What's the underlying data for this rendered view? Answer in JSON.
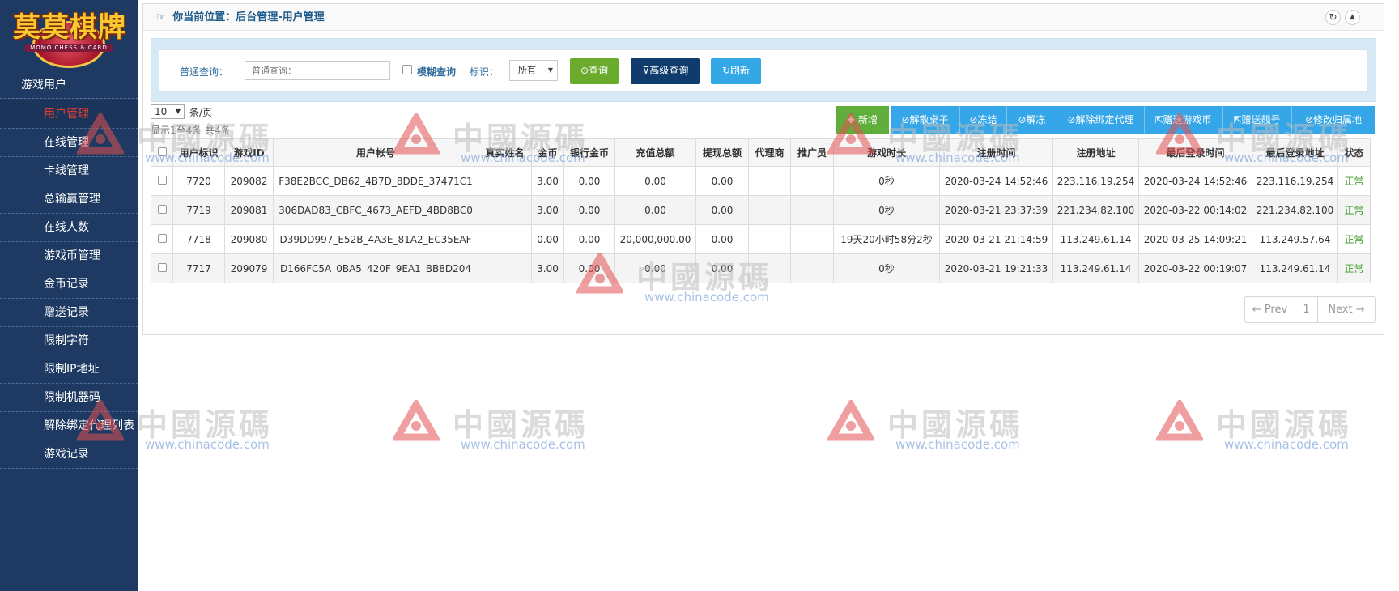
{
  "logo": {
    "title": "莫莫棋牌",
    "subtitle": "MOMO CHESS & CARD"
  },
  "sidebar": {
    "section_title": "游戏用户",
    "items": [
      {
        "label": "用户管理",
        "active": true
      },
      {
        "label": "在线管理"
      },
      {
        "label": "卡线管理"
      },
      {
        "label": "总输赢管理"
      },
      {
        "label": "在线人数"
      },
      {
        "label": "游戏币管理"
      },
      {
        "label": "金币记录"
      },
      {
        "label": "赠送记录"
      },
      {
        "label": "限制字符"
      },
      {
        "label": "限制IP地址"
      },
      {
        "label": "限制机器码"
      },
      {
        "label": "解除绑定代理列表"
      },
      {
        "label": "游戏记录"
      }
    ]
  },
  "header": {
    "pointer_icon": "hand-pointer-icon",
    "breadcrumb": "你当前位置：后台管理-用户管理",
    "refresh_icon": "refresh-icon",
    "collapse_icon": "chevron-up-icon"
  },
  "search": {
    "normal_label": "普通查询：",
    "normal_placeholder": "普通查询：",
    "fuzzy_label": "模糊查询",
    "mark_label": "标识：",
    "mark_value": "所有",
    "query_button": "查询",
    "advanced_button": "高级查询",
    "refresh_button": "刷新"
  },
  "toolbar": {
    "page_size": "10",
    "page_size_unit": "条/页",
    "records_info": "显示1至4条 共4条",
    "actions": [
      "新增",
      "解散桌子",
      "冻结",
      "解冻",
      "解除绑定代理",
      "赠送游戏币",
      "赠送靓号",
      "修改归属地"
    ]
  },
  "table": {
    "headers": [
      "用户标识",
      "游戏ID",
      "用户帐号",
      "真实姓名",
      "金币",
      "银行金币",
      "充值总额",
      "提现总额",
      "代理商",
      "推广员",
      "游戏时长",
      "注册时间",
      "注册地址",
      "最后登录时间",
      "最后登录地址",
      "状态"
    ],
    "rows": [
      [
        "7720",
        "209082",
        "F38E2BCC_DB62_4B7D_8DDE_37471C1",
        "",
        "3.00",
        "0.00",
        "0.00",
        "0.00",
        "",
        "",
        "0秒",
        "2020-03-24 14:52:46",
        "223.116.19.254",
        "2020-03-24 14:52:46",
        "223.116.19.254",
        "正常"
      ],
      [
        "7719",
        "209081",
        "306DAD83_CBFC_4673_AEFD_4BD8BC0",
        "",
        "3.00",
        "0.00",
        "0.00",
        "0.00",
        "",
        "",
        "0秒",
        "2020-03-21 23:37:39",
        "221.234.82.100",
        "2020-03-22 00:14:02",
        "221.234.82.100",
        "正常"
      ],
      [
        "7718",
        "209080",
        "D39DD997_E52B_4A3E_81A2_EC35EAF",
        "",
        "0.00",
        "0.00",
        "20,000,000.00",
        "0.00",
        "",
        "",
        "19天20小时58分2秒",
        "2020-03-21 21:14:59",
        "113.249.61.14",
        "2020-03-25 14:09:21",
        "113.249.57.64",
        "正常"
      ],
      [
        "7717",
        "209079",
        "D166FC5A_0BA5_420F_9EA1_BB8D204",
        "",
        "3.00",
        "0.00",
        "0.00",
        "0.00",
        "",
        "",
        "0秒",
        "2020-03-21 19:21:33",
        "113.249.61.14",
        "2020-03-22 00:19:07",
        "113.249.61.14",
        "正常"
      ]
    ]
  },
  "pagination": {
    "prev": "← Prev",
    "current": "1",
    "next": "Next →"
  },
  "watermark": {
    "text": "中國源碼",
    "url": "www.chinacode.com"
  },
  "colors": {
    "sidebar_bg": "#1e3a62",
    "active_menu": "#e23b30",
    "status_ok": "#3a9a21",
    "query_btn": "#6aab2e",
    "advanced_btn": "#0f3c6d",
    "refresh_btn": "#34a7e6"
  }
}
